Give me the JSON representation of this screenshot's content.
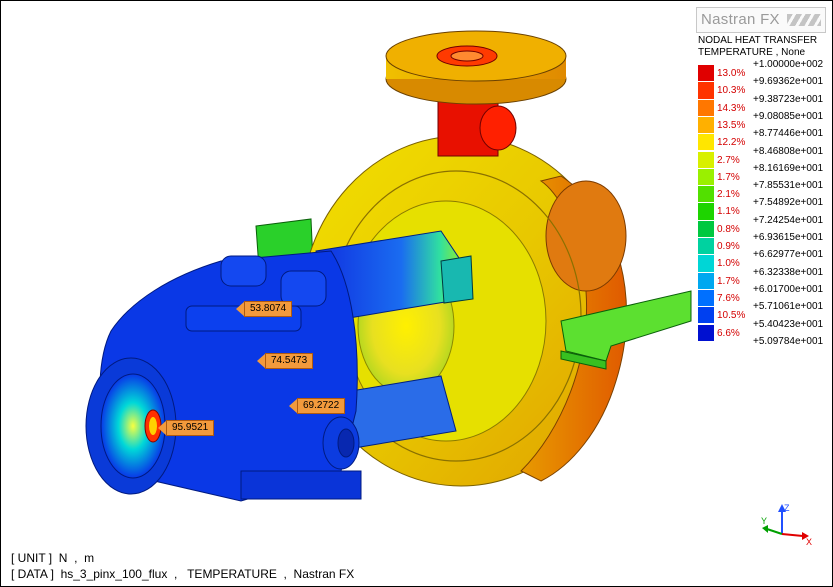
{
  "brand": {
    "logo_text": "Nastran FX"
  },
  "legend": {
    "title_line1": "NODAL HEAT TRANSFER",
    "title_line2": "TEMPERATURE , None",
    "ticks": [
      "+1.00000e+002",
      "+9.69362e+001",
      "+9.38723e+001",
      "+9.08085e+001",
      "+8.77446e+001",
      "+8.46808e+001",
      "+8.16169e+001",
      "+7.85531e+001",
      "+7.54892e+001",
      "+7.24254e+001",
      "+6.93615e+001",
      "+6.62977e+001",
      "+6.32338e+001",
      "+6.01700e+001",
      "+5.71061e+001",
      "+5.40423e+001",
      "+5.09784e+001"
    ],
    "percents": [
      "13.0%",
      "10.3%",
      "14.3%",
      "13.5%",
      "12.2%",
      "2.7%",
      "1.7%",
      "2.1%",
      "1.1%",
      "0.8%",
      "0.9%",
      "1.0%",
      "1.7%",
      "7.6%",
      "10.5%",
      "6.6%"
    ],
    "colors": [
      "#e00000",
      "#ff3300",
      "#ff7700",
      "#ffb000",
      "#ffe600",
      "#d8f000",
      "#9af000",
      "#52e000",
      "#1ed400",
      "#00c840",
      "#00d2a0",
      "#00d6d6",
      "#00a8f0",
      "#0070ff",
      "#0040f0",
      "#0010d0"
    ]
  },
  "probes": [
    "53.8074",
    "74.5473",
    "69.2722",
    "95.9521"
  ],
  "status": {
    "unit_line": "[ UNIT ]  N  ,  m",
    "data_line": "[ DATA ]  hs_3_pinx_100_flux  ,   TEMPERATURE  ,  Nastran FX"
  },
  "axis_labels": {
    "x": "X",
    "y": "Y",
    "z": "Z"
  }
}
